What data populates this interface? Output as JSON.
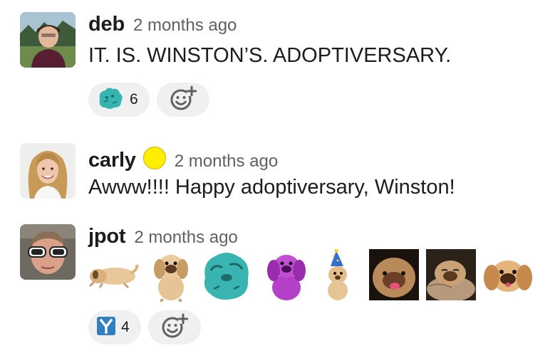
{
  "messages": [
    {
      "author": "deb",
      "time": "2 months ago",
      "text": "IT. IS. WINSTON’S. ADOPTIVERSARY.",
      "reactions": [
        {
          "emoji": "teal-dog-emoji",
          "count": "6"
        }
      ]
    },
    {
      "author": "carly",
      "status_emoji": "yellow-circle",
      "time": "2 months ago",
      "text": "Awww!!!! Happy adoptiversary, Winston!"
    },
    {
      "author": "jpot",
      "time": "2 months ago",
      "emoji_message": [
        "sleeping-dog-emoji",
        "pekingese-emoji",
        "teal-pekingese-emoji",
        "purple-pekingese-emoji",
        "party-hat-dog-emoji",
        "dog-face-photo-emoji",
        "dog-on-pillow-emoji",
        "dog-face-emoji"
      ],
      "reactions": [
        {
          "emoji": "y-letter-emoji",
          "count": "4"
        }
      ]
    }
  ],
  "icons": {
    "add_reaction": "add-reaction-icon"
  },
  "colors": {
    "accent": "#2f7fc1",
    "status": "#ffee00",
    "teal": "#36b5b0",
    "purple": "#b03fc6"
  }
}
